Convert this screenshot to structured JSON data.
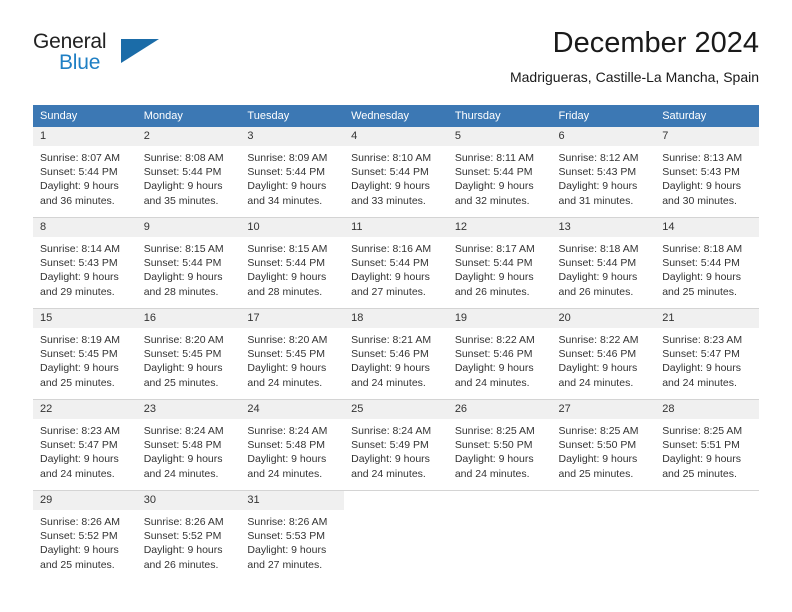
{
  "brand": {
    "name_part1": "General",
    "name_part2": "Blue",
    "triangle_color": "#1b6ca8",
    "blue_color": "#1f7fc4"
  },
  "header": {
    "title": "December 2024",
    "subtitle": "Madrigueras, Castille-La Mancha, Spain"
  },
  "theme": {
    "header_row_bg": "#3c78b4",
    "daynum_bg": "#f0f0f0",
    "text_color": "#333333",
    "grid_line": "#d4d4d4"
  },
  "calendar": {
    "day_headers": [
      "Sunday",
      "Monday",
      "Tuesday",
      "Wednesday",
      "Thursday",
      "Friday",
      "Saturday"
    ],
    "weeks": [
      [
        {
          "day": "1",
          "sunrise": "Sunrise: 8:07 AM",
          "sunset": "Sunset: 5:44 PM",
          "daylight1": "Daylight: 9 hours",
          "daylight2": "and 36 minutes."
        },
        {
          "day": "2",
          "sunrise": "Sunrise: 8:08 AM",
          "sunset": "Sunset: 5:44 PM",
          "daylight1": "Daylight: 9 hours",
          "daylight2": "and 35 minutes."
        },
        {
          "day": "3",
          "sunrise": "Sunrise: 8:09 AM",
          "sunset": "Sunset: 5:44 PM",
          "daylight1": "Daylight: 9 hours",
          "daylight2": "and 34 minutes."
        },
        {
          "day": "4",
          "sunrise": "Sunrise: 8:10 AM",
          "sunset": "Sunset: 5:44 PM",
          "daylight1": "Daylight: 9 hours",
          "daylight2": "and 33 minutes."
        },
        {
          "day": "5",
          "sunrise": "Sunrise: 8:11 AM",
          "sunset": "Sunset: 5:44 PM",
          "daylight1": "Daylight: 9 hours",
          "daylight2": "and 32 minutes."
        },
        {
          "day": "6",
          "sunrise": "Sunrise: 8:12 AM",
          "sunset": "Sunset: 5:43 PM",
          "daylight1": "Daylight: 9 hours",
          "daylight2": "and 31 minutes."
        },
        {
          "day": "7",
          "sunrise": "Sunrise: 8:13 AM",
          "sunset": "Sunset: 5:43 PM",
          "daylight1": "Daylight: 9 hours",
          "daylight2": "and 30 minutes."
        }
      ],
      [
        {
          "day": "8",
          "sunrise": "Sunrise: 8:14 AM",
          "sunset": "Sunset: 5:43 PM",
          "daylight1": "Daylight: 9 hours",
          "daylight2": "and 29 minutes."
        },
        {
          "day": "9",
          "sunrise": "Sunrise: 8:15 AM",
          "sunset": "Sunset: 5:44 PM",
          "daylight1": "Daylight: 9 hours",
          "daylight2": "and 28 minutes."
        },
        {
          "day": "10",
          "sunrise": "Sunrise: 8:15 AM",
          "sunset": "Sunset: 5:44 PM",
          "daylight1": "Daylight: 9 hours",
          "daylight2": "and 28 minutes."
        },
        {
          "day": "11",
          "sunrise": "Sunrise: 8:16 AM",
          "sunset": "Sunset: 5:44 PM",
          "daylight1": "Daylight: 9 hours",
          "daylight2": "and 27 minutes."
        },
        {
          "day": "12",
          "sunrise": "Sunrise: 8:17 AM",
          "sunset": "Sunset: 5:44 PM",
          "daylight1": "Daylight: 9 hours",
          "daylight2": "and 26 minutes."
        },
        {
          "day": "13",
          "sunrise": "Sunrise: 8:18 AM",
          "sunset": "Sunset: 5:44 PM",
          "daylight1": "Daylight: 9 hours",
          "daylight2": "and 26 minutes."
        },
        {
          "day": "14",
          "sunrise": "Sunrise: 8:18 AM",
          "sunset": "Sunset: 5:44 PM",
          "daylight1": "Daylight: 9 hours",
          "daylight2": "and 25 minutes."
        }
      ],
      [
        {
          "day": "15",
          "sunrise": "Sunrise: 8:19 AM",
          "sunset": "Sunset: 5:45 PM",
          "daylight1": "Daylight: 9 hours",
          "daylight2": "and 25 minutes."
        },
        {
          "day": "16",
          "sunrise": "Sunrise: 8:20 AM",
          "sunset": "Sunset: 5:45 PM",
          "daylight1": "Daylight: 9 hours",
          "daylight2": "and 25 minutes."
        },
        {
          "day": "17",
          "sunrise": "Sunrise: 8:20 AM",
          "sunset": "Sunset: 5:45 PM",
          "daylight1": "Daylight: 9 hours",
          "daylight2": "and 24 minutes."
        },
        {
          "day": "18",
          "sunrise": "Sunrise: 8:21 AM",
          "sunset": "Sunset: 5:46 PM",
          "daylight1": "Daylight: 9 hours",
          "daylight2": "and 24 minutes."
        },
        {
          "day": "19",
          "sunrise": "Sunrise: 8:22 AM",
          "sunset": "Sunset: 5:46 PM",
          "daylight1": "Daylight: 9 hours",
          "daylight2": "and 24 minutes."
        },
        {
          "day": "20",
          "sunrise": "Sunrise: 8:22 AM",
          "sunset": "Sunset: 5:46 PM",
          "daylight1": "Daylight: 9 hours",
          "daylight2": "and 24 minutes."
        },
        {
          "day": "21",
          "sunrise": "Sunrise: 8:23 AM",
          "sunset": "Sunset: 5:47 PM",
          "daylight1": "Daylight: 9 hours",
          "daylight2": "and 24 minutes."
        }
      ],
      [
        {
          "day": "22",
          "sunrise": "Sunrise: 8:23 AM",
          "sunset": "Sunset: 5:47 PM",
          "daylight1": "Daylight: 9 hours",
          "daylight2": "and 24 minutes."
        },
        {
          "day": "23",
          "sunrise": "Sunrise: 8:24 AM",
          "sunset": "Sunset: 5:48 PM",
          "daylight1": "Daylight: 9 hours",
          "daylight2": "and 24 minutes."
        },
        {
          "day": "24",
          "sunrise": "Sunrise: 8:24 AM",
          "sunset": "Sunset: 5:48 PM",
          "daylight1": "Daylight: 9 hours",
          "daylight2": "and 24 minutes."
        },
        {
          "day": "25",
          "sunrise": "Sunrise: 8:24 AM",
          "sunset": "Sunset: 5:49 PM",
          "daylight1": "Daylight: 9 hours",
          "daylight2": "and 24 minutes."
        },
        {
          "day": "26",
          "sunrise": "Sunrise: 8:25 AM",
          "sunset": "Sunset: 5:50 PM",
          "daylight1": "Daylight: 9 hours",
          "daylight2": "and 24 minutes."
        },
        {
          "day": "27",
          "sunrise": "Sunrise: 8:25 AM",
          "sunset": "Sunset: 5:50 PM",
          "daylight1": "Daylight: 9 hours",
          "daylight2": "and 25 minutes."
        },
        {
          "day": "28",
          "sunrise": "Sunrise: 8:25 AM",
          "sunset": "Sunset: 5:51 PM",
          "daylight1": "Daylight: 9 hours",
          "daylight2": "and 25 minutes."
        }
      ],
      [
        {
          "day": "29",
          "sunrise": "Sunrise: 8:26 AM",
          "sunset": "Sunset: 5:52 PM",
          "daylight1": "Daylight: 9 hours",
          "daylight2": "and 25 minutes."
        },
        {
          "day": "30",
          "sunrise": "Sunrise: 8:26 AM",
          "sunset": "Sunset: 5:52 PM",
          "daylight1": "Daylight: 9 hours",
          "daylight2": "and 26 minutes."
        },
        {
          "day": "31",
          "sunrise": "Sunrise: 8:26 AM",
          "sunset": "Sunset: 5:53 PM",
          "daylight1": "Daylight: 9 hours",
          "daylight2": "and 27 minutes."
        },
        {
          "day": "",
          "sunrise": "",
          "sunset": "",
          "daylight1": "",
          "daylight2": ""
        },
        {
          "day": "",
          "sunrise": "",
          "sunset": "",
          "daylight1": "",
          "daylight2": ""
        },
        {
          "day": "",
          "sunrise": "",
          "sunset": "",
          "daylight1": "",
          "daylight2": ""
        },
        {
          "day": "",
          "sunrise": "",
          "sunset": "",
          "daylight1": "",
          "daylight2": ""
        }
      ]
    ]
  }
}
